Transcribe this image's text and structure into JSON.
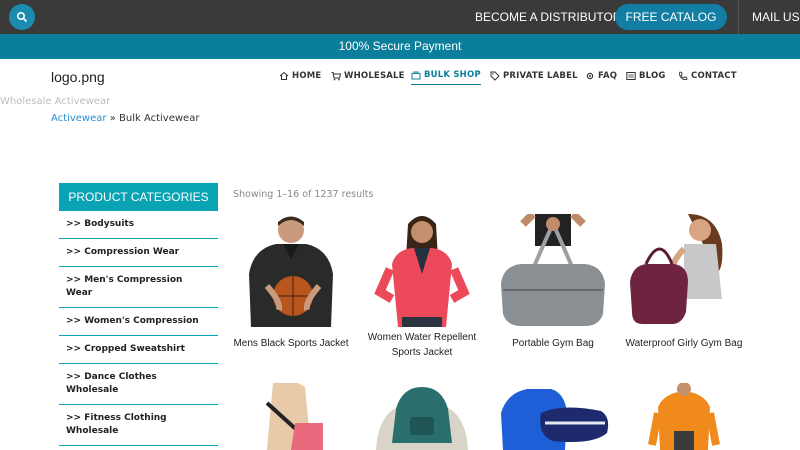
{
  "topbar": {
    "distributor_label": "BECOME A DISTRIBUTOR",
    "catalog_label": "FREE CATALOG",
    "mail_label": "MAIL US"
  },
  "secure_bar": "100% Secure Payment",
  "logo": "logo.png",
  "nav": {
    "home": "HOME",
    "wholesale": "WHOLESALE",
    "bulk_shop": "BULK SHOP",
    "private_label": "PRIVATE LABEL",
    "faq": "FAQ",
    "blog": "BLOG",
    "contact": "CONTACT"
  },
  "page_title": "Wholesale Activewear",
  "breadcrumb": {
    "parent": "Activewear",
    "separator": " » ",
    "current": "Bulk Activewear"
  },
  "sidebar": {
    "heading": "PRODUCT CATEGORIES",
    "items": [
      {
        "label": ">>  Bodysuits"
      },
      {
        "label": ">>  Compression Wear"
      },
      {
        "label": ">>  Men's Compression Wear"
      },
      {
        "label": ">>  Women's Compression"
      },
      {
        "label": ">>  Cropped Sweatshirt"
      },
      {
        "label": ">>  Dance Clothes Wholesale"
      },
      {
        "label": ">>  Fitness Clothing Wholesale"
      }
    ]
  },
  "results_text": "Showing 1–16 of 1237 results",
  "products": [
    {
      "name": "Mens Black Sports Jacket"
    },
    {
      "name": "Women Water Repellent Sports Jacket"
    },
    {
      "name": "Portable Gym Bag"
    },
    {
      "name": "Waterproof Girly Gym Bag"
    }
  ],
  "colors": {
    "topbar": "#3a3a3a",
    "accent": "#0b7e9b",
    "sidebar_head": "#0aa3b3",
    "link": "#2a8fd0"
  }
}
